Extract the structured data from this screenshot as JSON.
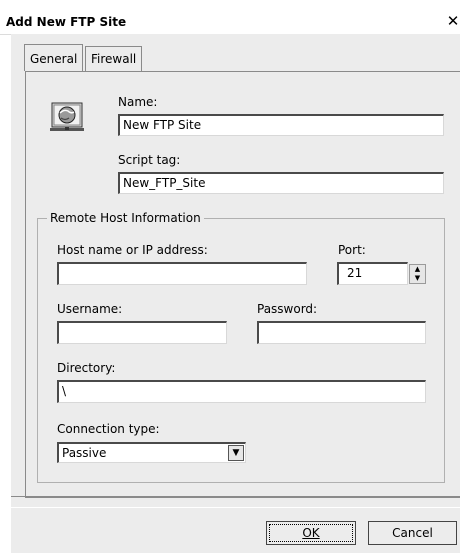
{
  "window": {
    "title": "Add New FTP Site",
    "close_glyph": "✕"
  },
  "tabs": [
    {
      "label": "General",
      "active": true
    },
    {
      "label": "Firewall",
      "active": false
    }
  ],
  "general": {
    "name_label": "Name:",
    "name_value": "New FTP Site",
    "script_tag_label": "Script tag:",
    "script_tag_value": "New_FTP_Site"
  },
  "remote_host": {
    "legend": "Remote Host Information",
    "host_label": "Host name or IP address:",
    "host_value": "",
    "port_label": "Port:",
    "port_value": "21",
    "username_label": "Username:",
    "username_value": "",
    "password_label": "Password:",
    "password_value": "",
    "directory_label": "Directory:",
    "directory_value": "\\",
    "connection_type_label": "Connection type:",
    "connection_type_value": "Passive"
  },
  "buttons": {
    "ok": "OK",
    "cancel": "Cancel"
  },
  "icons": {
    "site": "ftp-site-icon",
    "close": "close-icon",
    "spin_up": "spin-up-icon",
    "spin_down": "spin-down-icon",
    "dropdown": "chevron-down-icon"
  }
}
